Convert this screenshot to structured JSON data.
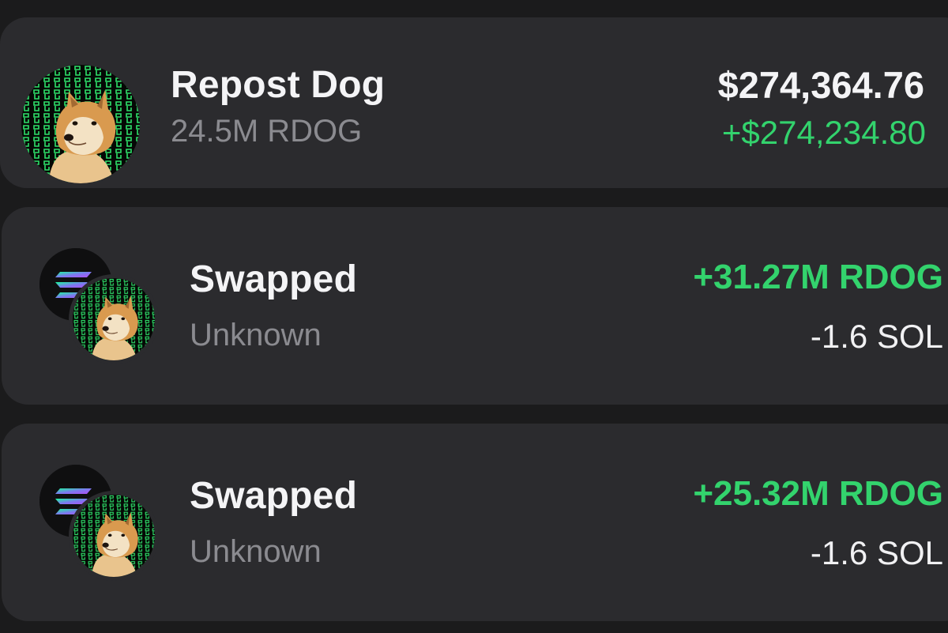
{
  "holding": {
    "name": "Repost Dog",
    "amount": "24.5M RDOG",
    "value": "$274,364.76",
    "change": "+$274,234.80"
  },
  "transactions": [
    {
      "title": "Swapped",
      "subtitle": "Unknown",
      "received": "+31.27M RDOG",
      "sent": "-1.6 SOL"
    },
    {
      "title": "Swapped",
      "subtitle": "Unknown",
      "received": "+25.32M RDOG",
      "sent": "-1.6 SOL"
    }
  ],
  "colors": {
    "background": "#1b1b1c",
    "card": "#2b2b2e",
    "positive": "#33d36d",
    "muted": "#8b8b90",
    "text": "#f4f4f6"
  },
  "icons": {
    "token": "repost-dog-token-icon",
    "sol": "solana-icon"
  }
}
